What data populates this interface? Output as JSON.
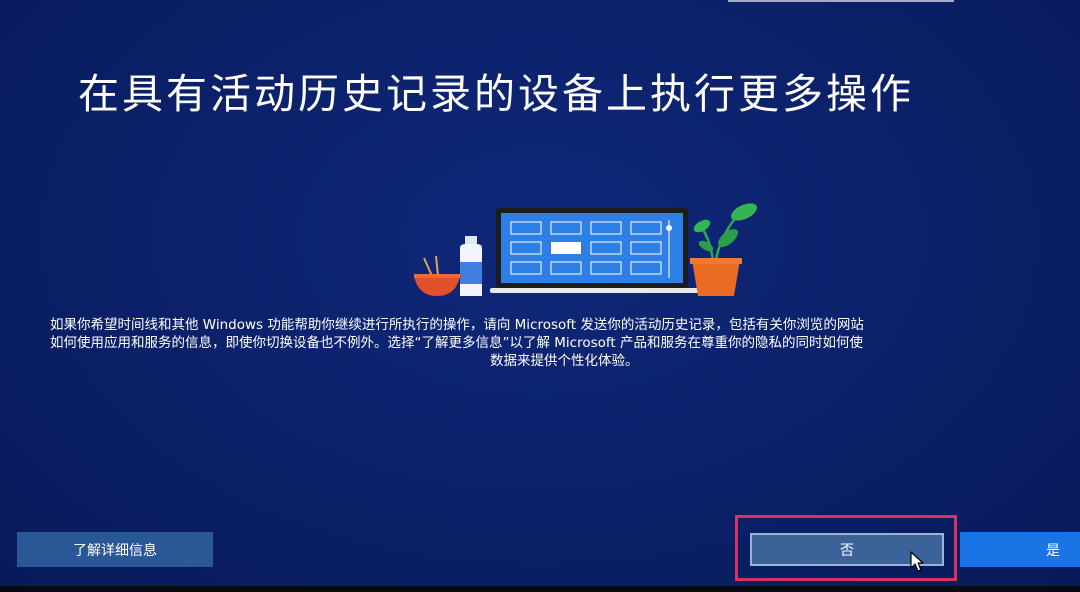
{
  "page": {
    "title": "在具有活动历史记录的设备上执行更多操作",
    "body_lines": [
      "如果你希望时间线和其他 Windows 功能帮助你继续进行所执行的操作，请向 Microsoft 发送你的活动历史记录，包括有关你浏览的网站",
      "如何使用应用和服务的信息，即使你切换设备也不例外。选择“了解更多信息”以了解 Microsoft 产品和服务在尊重你的隐私的同时如何使",
      "数据来提供个性化体验。"
    ]
  },
  "buttons": {
    "learn_more": "了解详细信息",
    "no": "否",
    "yes": "是"
  },
  "icons": {
    "illustration": "laptop-timeline-illustration",
    "cursor": "mouse-pointer-icon"
  },
  "colors": {
    "background": "#0b2068",
    "primary_button": "#1a74e6",
    "secondary_button": "#3b6299",
    "highlight": "#d9325e"
  }
}
